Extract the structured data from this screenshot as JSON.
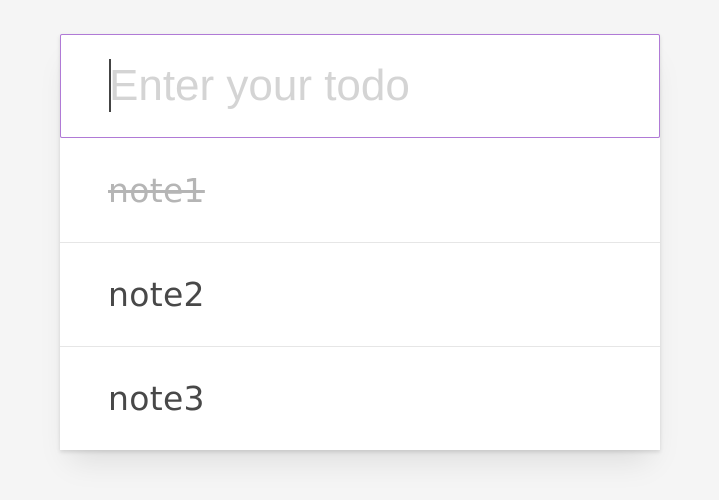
{
  "new_todo": {
    "value": "",
    "placeholder": "Enter your todo"
  },
  "todos": [
    {
      "label": "note1",
      "completed": true
    },
    {
      "label": "note2",
      "completed": false
    },
    {
      "label": "note3",
      "completed": false
    }
  ],
  "colors": {
    "focus_border": "#b07ad6",
    "placeholder": "#d4d4d4",
    "text": "#484848",
    "completed_text": "#b5b5b5",
    "background": "#f5f5f5"
  }
}
